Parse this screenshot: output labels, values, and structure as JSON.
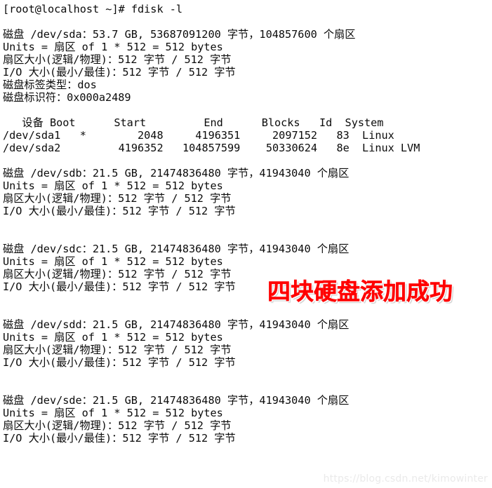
{
  "terminal": {
    "background_color": "#ffffff",
    "text_color": "#0b0b0b",
    "prompt_line": "[root@localhost ~]# fdisk -l",
    "lines": [
      "[root@localhost ~]# fdisk -l",
      "",
      "磁盘 /dev/sda：53.7 GB, 53687091200 字节，104857600 个扇区",
      "Units = 扇区 of 1 * 512 = 512 bytes",
      "扇区大小(逻辑/物理)：512 字节 / 512 字节",
      "I/O 大小(最小/最佳)：512 字节 / 512 字节",
      "磁盘标签类型：dos",
      "磁盘标识符：0x000a2489",
      "",
      "   设备 Boot      Start         End      Blocks   Id  System",
      "/dev/sda1   *        2048     4196351     2097152   83  Linux",
      "/dev/sda2         4196352   104857599    50330624   8e  Linux LVM",
      "",
      "磁盘 /dev/sdb：21.5 GB, 21474836480 字节，41943040 个扇区",
      "Units = 扇区 of 1 * 512 = 512 bytes",
      "扇区大小(逻辑/物理)：512 字节 / 512 字节",
      "I/O 大小(最小/最佳)：512 字节 / 512 字节",
      "",
      "",
      "磁盘 /dev/sdc：21.5 GB, 21474836480 字节，41943040 个扇区",
      "Units = 扇区 of 1 * 512 = 512 bytes",
      "扇区大小(逻辑/物理)：512 字节 / 512 字节",
      "I/O 大小(最小/最佳)：512 字节 / 512 字节",
      "",
      "",
      "磁盘 /dev/sdd：21.5 GB, 21474836480 字节，41943040 个扇区",
      "Units = 扇区 of 1 * 512 = 512 bytes",
      "扇区大小(逻辑/物理)：512 字节 / 512 字节",
      "I/O 大小(最小/最佳)：512 字节 / 512 字节",
      "",
      "",
      "磁盘 /dev/sde：21.5 GB, 21474836480 字节，41943040 个扇区",
      "Units = 扇区 of 1 * 512 = 512 bytes",
      "扇区大小(逻辑/物理)：512 字节 / 512 字节",
      "I/O 大小(最小/最佳)：512 字节 / 512 字节"
    ],
    "command": {
      "prompt": "[root@localhost ~]#",
      "user": "root",
      "host": "localhost",
      "cwd": "~",
      "text": "fdisk -l"
    },
    "disks": [
      {
        "name": "/dev/sda",
        "size_human": "53.7 GB",
        "size_bytes": "53687091200",
        "sectors": "104857600",
        "header_line": "磁盘 /dev/sda：53.7 GB, 53687091200 字节，104857600 个扇区",
        "units_line": "Units = 扇区 of 1 * 512 = 512 bytes",
        "sector_size_line": "扇区大小(逻辑/物理)：512 字节 / 512 字节",
        "io_size_line": "I/O 大小(最小/最佳)：512 字节 / 512 字节",
        "label_type_line": "磁盘标签类型：dos",
        "identifier_line": "磁盘标识符：0x000a2489",
        "label_type": "dos",
        "identifier": "0x000a2489"
      },
      {
        "name": "/dev/sdb",
        "size_human": "21.5 GB",
        "size_bytes": "21474836480",
        "sectors": "41943040",
        "header_line": "磁盘 /dev/sdb：21.5 GB, 21474836480 字节，41943040 个扇区",
        "units_line": "Units = 扇区 of 1 * 512 = 512 bytes",
        "sector_size_line": "扇区大小(逻辑/物理)：512 字节 / 512 字节",
        "io_size_line": "I/O 大小(最小/最佳)：512 字节 / 512 字节"
      },
      {
        "name": "/dev/sdc",
        "size_human": "21.5 GB",
        "size_bytes": "21474836480",
        "sectors": "41943040",
        "header_line": "磁盘 /dev/sdc：21.5 GB, 21474836480 字节，41943040 个扇区",
        "units_line": "Units = 扇区 of 1 * 512 = 512 bytes",
        "sector_size_line": "扇区大小(逻辑/物理)：512 字节 / 512 字节",
        "io_size_line": "I/O 大小(最小/最佳)：512 字节 / 512 字节"
      },
      {
        "name": "/dev/sdd",
        "size_human": "21.5 GB",
        "size_bytes": "21474836480",
        "sectors": "41943040",
        "header_line": "磁盘 /dev/sdd：21.5 GB, 21474836480 字节，41943040 个扇区",
        "units_line": "Units = 扇区 of 1 * 512 = 512 bytes",
        "sector_size_line": "扇区大小(逻辑/物理)：512 字节 / 512 字节",
        "io_size_line": "I/O 大小(最小/最佳)：512 字节 / 512 字节"
      },
      {
        "name": "/dev/sde",
        "size_human": "21.5 GB",
        "size_bytes": "21474836480",
        "sectors": "41943040",
        "header_line": "磁盘 /dev/sde：21.5 GB, 21474836480 字节，41943040 个扇区",
        "units_line": "Units = 扇区 of 1 * 512 = 512 bytes",
        "sector_size_line": "扇区大小(逻辑/物理)：512 字节 / 512 字节",
        "io_size_line": "I/O 大小(最小/最佳)：512 字节 / 512 字节"
      }
    ],
    "partition_table": {
      "header_line": "   设备 Boot      Start         End      Blocks   Id  System",
      "columns": [
        "设备",
        "Boot",
        "Start",
        "End",
        "Blocks",
        "Id",
        "System"
      ],
      "rows": [
        {
          "line": "/dev/sda1   *        2048     4196351     2097152   83  Linux",
          "device": "/dev/sda1",
          "boot": "*",
          "start": "2048",
          "end": "4196351",
          "blocks": "2097152",
          "id": "83",
          "system": "Linux"
        },
        {
          "line": "/dev/sda2         4196352   104857599    50330624   8e  Linux LVM",
          "device": "/dev/sda2",
          "boot": "",
          "start": "4196352",
          "end": "104857599",
          "blocks": "50330624",
          "id": "8e",
          "system": "Linux LVM"
        }
      ]
    }
  },
  "annotation": {
    "text": "四块硬盘添加成功",
    "color": "#fe0000",
    "outline_color": "#ffffff"
  },
  "watermark": {
    "text": "https://blog.csdn.net/kimowinter",
    "color": "#eaeaea"
  }
}
